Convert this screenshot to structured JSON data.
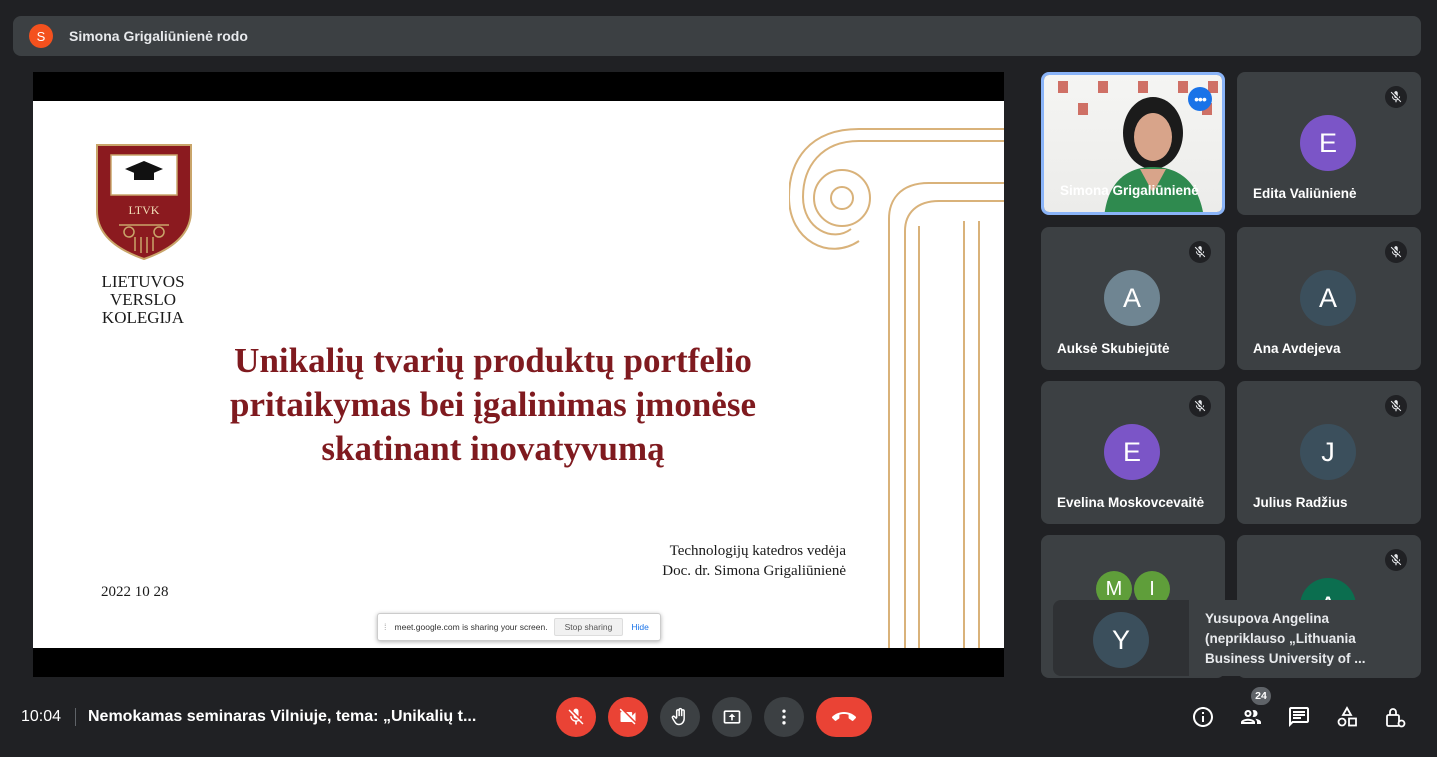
{
  "presenter_banner": {
    "avatar_letter": "S",
    "text": "Simona Grigaliūnienė rodo"
  },
  "slide": {
    "logo_text": [
      "LIETUVOS",
      "VERSLO",
      "KOLEGIJA"
    ],
    "logo_abbr": "LTVK",
    "title_lines": [
      "Unikalių tvarių produktų portfelio",
      "pritaikymas bei įgalinimas įmonėse",
      "skatinant inovatyvumą"
    ],
    "author_lines": [
      "Technologijų katedros vedėja",
      "Doc. dr. Simona Grigaliūnienė"
    ],
    "date": "2022 10 28",
    "colors": {
      "title": "#7f1a1f",
      "deco": "#d9b27a"
    }
  },
  "share_notice": {
    "message": "meet.google.com is sharing your screen.",
    "stop_label": "Stop sharing",
    "hide_label": "Hide"
  },
  "participants": [
    {
      "name": "Simona Grigaliūnienė",
      "video": true,
      "active": true
    },
    {
      "name": "Edita Valiūnienė",
      "letter": "E",
      "color": "#7b55c7",
      "muted": true
    },
    {
      "name": "Auksė Skubiejūtė",
      "letter": "A",
      "color": "#6f8592",
      "muted": true
    },
    {
      "name": "Ana Avdejeva",
      "letter": "A",
      "color": "#3b4f5c",
      "muted": true
    },
    {
      "name": "Evelina Moskovcevaitė",
      "letter": "E",
      "color": "#7b55c7",
      "muted": true
    },
    {
      "name": "Julius Radžius",
      "letter": "J",
      "color": "#3b4f5c",
      "muted": true
    }
  ],
  "partial_tiles": [
    {
      "letters": [
        "M",
        "I"
      ],
      "colors": [
        "#5f9e3a",
        "#5f9e3a"
      ]
    },
    {
      "letter": "A",
      "color": "#0b6e4f",
      "muted": true
    }
  ],
  "overflow_card": {
    "letter": "Y",
    "label": "Yusupova Angelina (nepriklauso „Lithuania Business University of ..."
  },
  "bottom": {
    "time": "10:04",
    "meeting_title": "Nemokamas seminaras Vilniuje, tema: „Unikalių t...",
    "participant_count": "24"
  }
}
